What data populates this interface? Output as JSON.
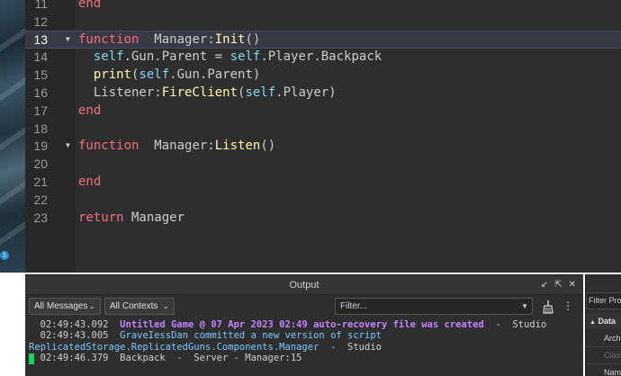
{
  "viewport": {
    "badge": "1"
  },
  "editor": {
    "lines": [
      {
        "n": "11",
        "fold": "",
        "segments": [
          [
            "kw",
            "end"
          ]
        ]
      },
      {
        "n": "12",
        "fold": "",
        "segments": []
      },
      {
        "n": "13",
        "fold": "▼",
        "active": true,
        "segments": [
          [
            "kw",
            "function"
          ],
          [
            "",
            "  Manager:"
          ],
          [
            "fn",
            "Init"
          ],
          [
            "",
            "()"
          ]
        ]
      },
      {
        "n": "14",
        "fold": "",
        "segments": [
          [
            "",
            "  "
          ],
          [
            "self",
            "self"
          ],
          [
            "",
            ".Gun.Parent = "
          ],
          [
            "self",
            "self"
          ],
          [
            "",
            ".Player.Backpack"
          ]
        ]
      },
      {
        "n": "15",
        "fold": "",
        "segments": [
          [
            "",
            "  "
          ],
          [
            "fn",
            "print"
          ],
          [
            "",
            "("
          ],
          [
            "self",
            "self"
          ],
          [
            "",
            ".Gun.Parent)"
          ]
        ]
      },
      {
        "n": "16",
        "fold": "",
        "segments": [
          [
            "",
            "  Listener:"
          ],
          [
            "fn",
            "FireClient"
          ],
          [
            "",
            "("
          ],
          [
            "self",
            "self"
          ],
          [
            "",
            ".Player)"
          ]
        ]
      },
      {
        "n": "17",
        "fold": "",
        "segments": [
          [
            "kw",
            "end"
          ]
        ]
      },
      {
        "n": "18",
        "fold": "",
        "segments": []
      },
      {
        "n": "19",
        "fold": "▼",
        "segments": [
          [
            "kw",
            "function"
          ],
          [
            "",
            "  Manager:"
          ],
          [
            "fn",
            "Listen"
          ],
          [
            "",
            "()"
          ]
        ]
      },
      {
        "n": "20",
        "fold": "",
        "segments": []
      },
      {
        "n": "21",
        "fold": "",
        "segments": [
          [
            "kw",
            "end"
          ]
        ]
      },
      {
        "n": "22",
        "fold": "",
        "segments": []
      },
      {
        "n": "23",
        "fold": "",
        "segments": [
          [
            "kw",
            "return"
          ],
          [
            "",
            " Manager"
          ]
        ]
      }
    ]
  },
  "output": {
    "title": "Output",
    "dock_icon": "↙",
    "popout_icon": "⇱",
    "close_icon": "✕",
    "messages_filter": "All Messages",
    "contexts_filter": "All Contexts",
    "filter_placeholder": "Filter...",
    "more_icon": "⋮",
    "log": [
      {
        "ts": "  02:49:43.092",
        "text": "Untitled Game @ 07 Apr 2023 02:49 auto-recovery file was created",
        "style": "warn",
        "src": "  -  Studio"
      },
      {
        "ts": "  02:49:43.005",
        "text": "GraveIessDan committed a new version of script",
        "style": "info",
        "src": ""
      },
      {
        "ts": "",
        "text": "ReplicatedStorage.ReplicatedGuns.Components.Manager",
        "style": "info",
        "src": "  -  Studio"
      },
      {
        "ts": "  02:49:46.379",
        "text": "Backpack",
        "style": "plain",
        "src": "  -  Server - Manager:15"
      }
    ]
  },
  "properties": {
    "filter": "Filter Prop",
    "section": "Data",
    "rows": [
      {
        "label": "Archiv",
        "color": "#d4d4d4"
      },
      {
        "label": "Class",
        "color": "#6f6f6f"
      },
      {
        "label": "Name",
        "color": "#d4d4d4"
      }
    ]
  }
}
